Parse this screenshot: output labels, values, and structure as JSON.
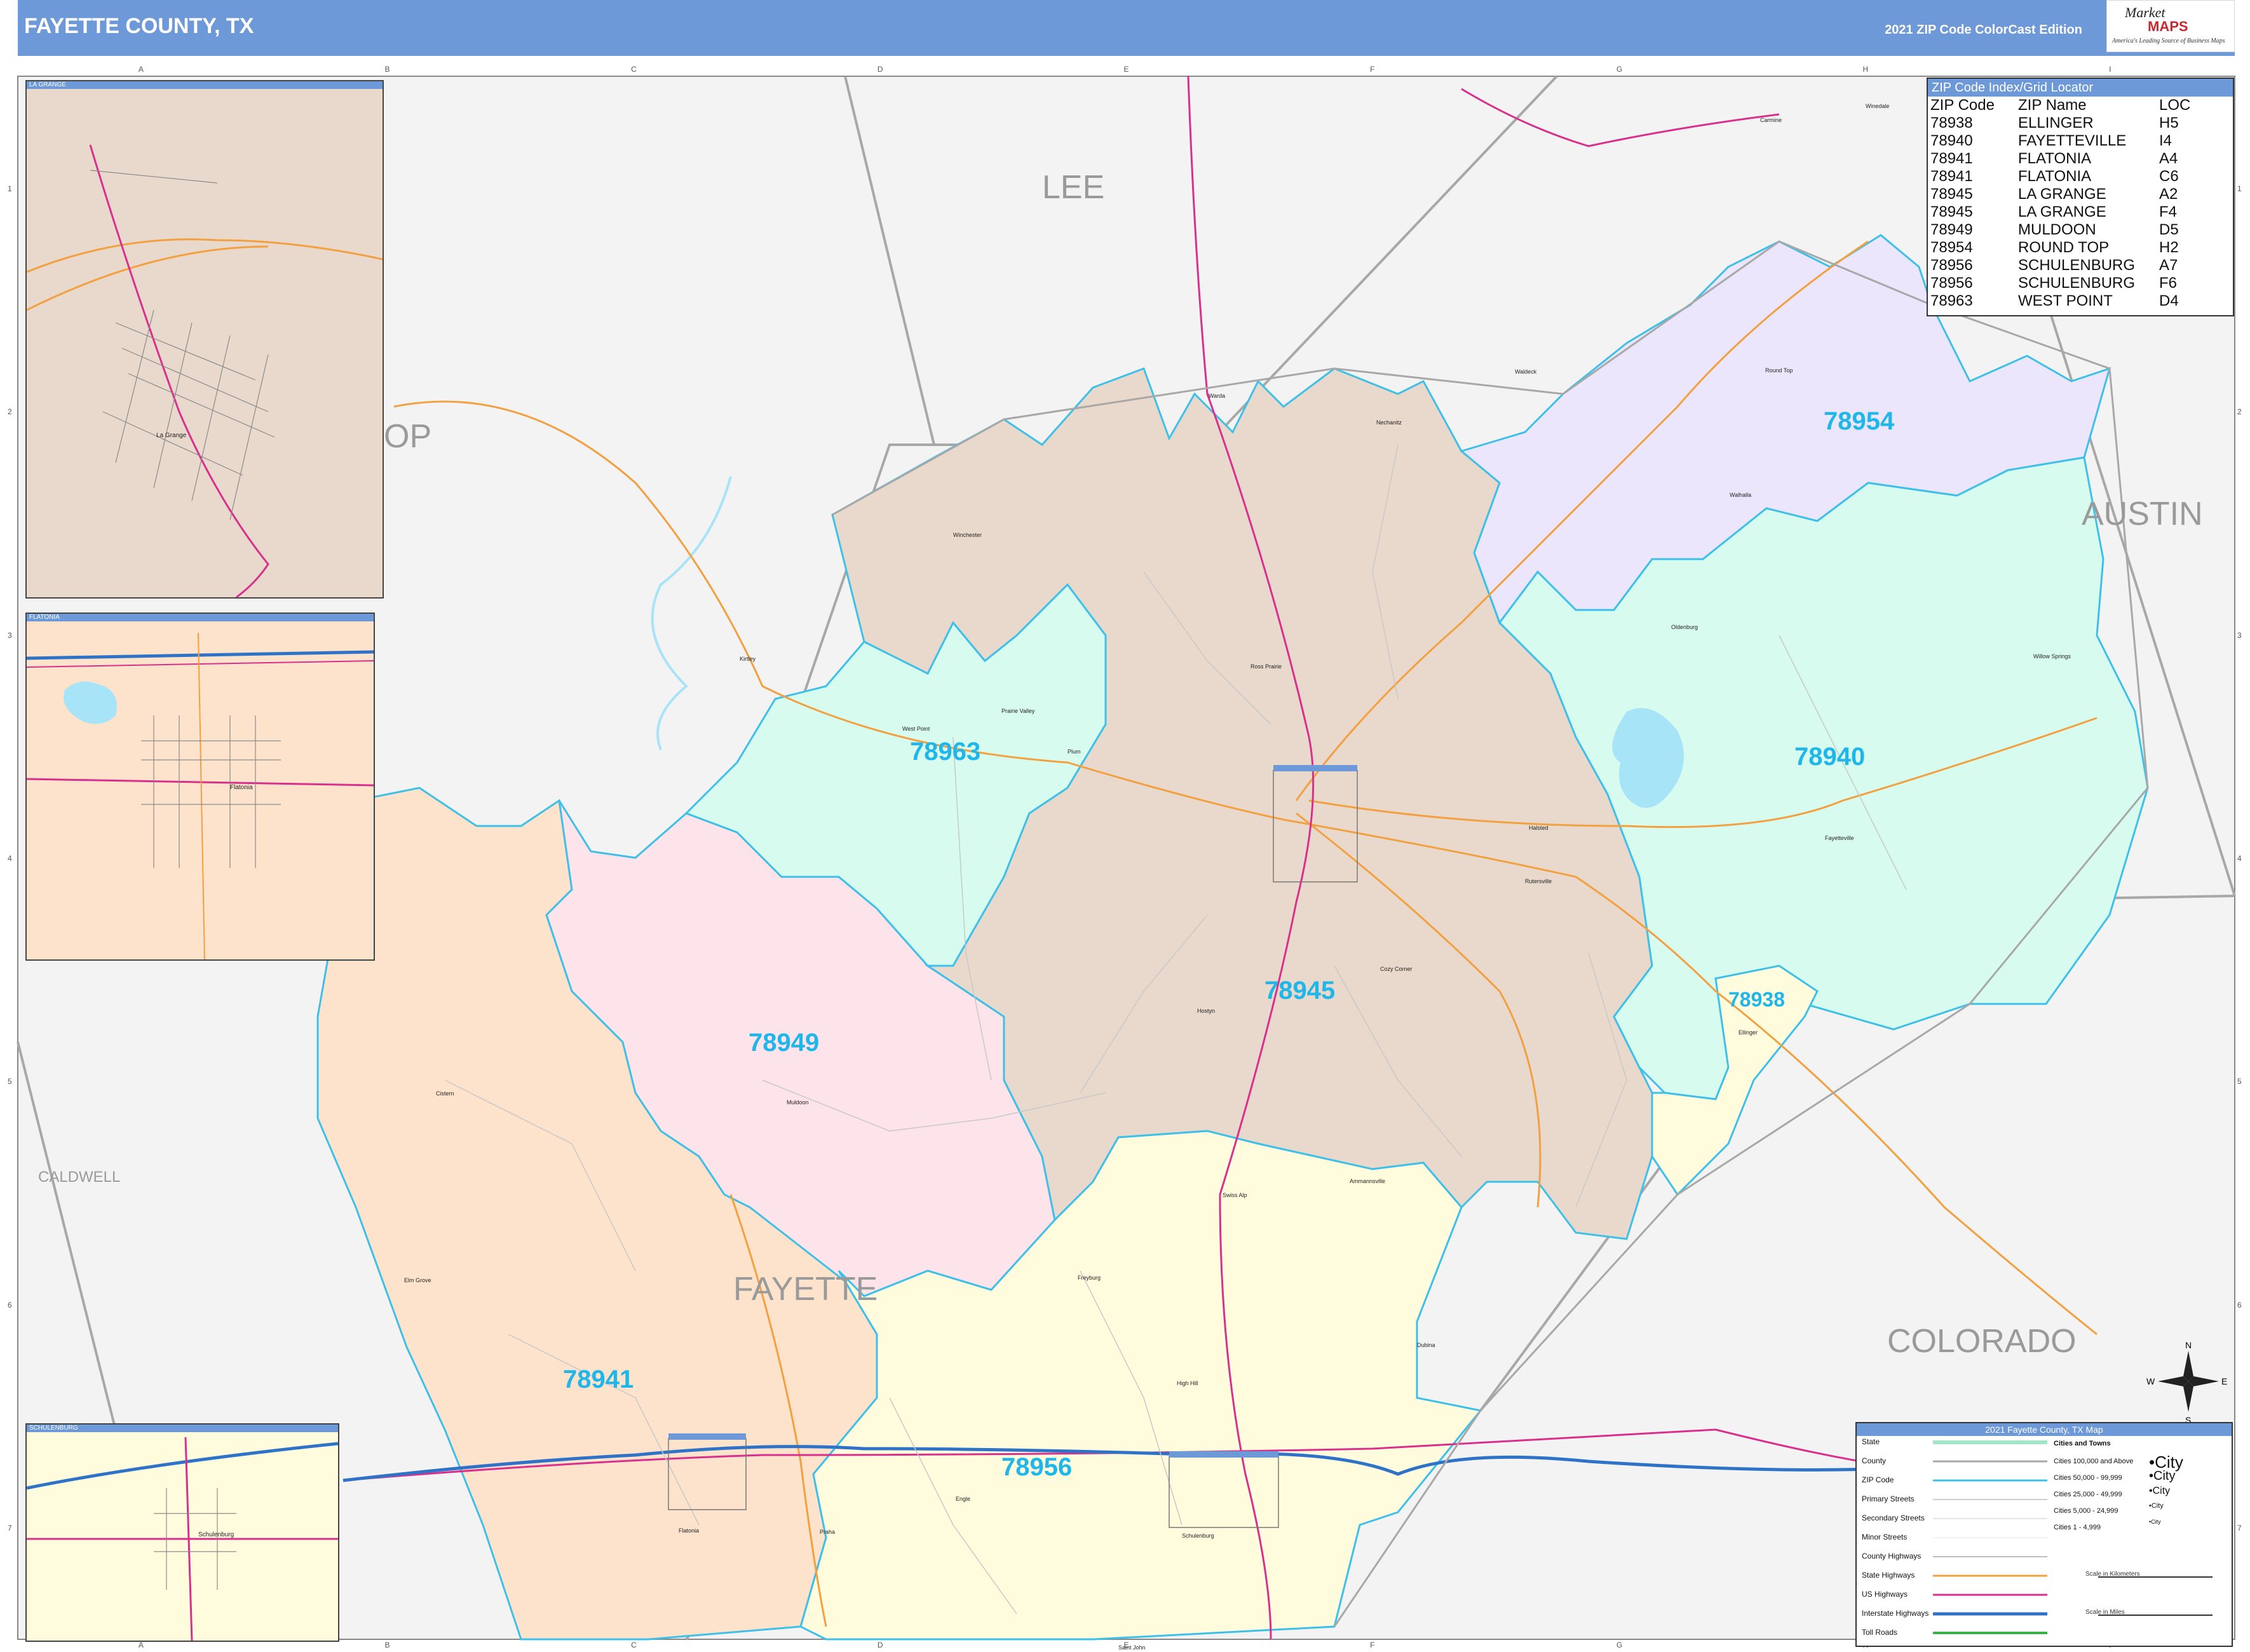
{
  "header": {
    "title": "FAYETTE COUNTY, TX",
    "edition": "2021 ZIP Code ColorCast Edition"
  },
  "logo": {
    "brand_a": "Market",
    "brand_b": "MAPS",
    "tagline": "America's Leading Source of Business Maps"
  },
  "grid": {
    "columns": [
      "A",
      "B",
      "C",
      "D",
      "E",
      "F",
      "G",
      "H",
      "I"
    ],
    "rows": [
      "1",
      "2",
      "3",
      "4",
      "5",
      "6",
      "7"
    ]
  },
  "counties": {
    "lee": "LEE",
    "bastrop_partial": "OP",
    "austin": "AUSTIN",
    "caldwell": "CALDWELL",
    "colorado": "COLORADO",
    "fayette": "FAYETTE"
  },
  "zip_areas": [
    {
      "zip": "78954",
      "color": "#ebe6fb"
    },
    {
      "zip": "78940",
      "color": "#d7fbee"
    },
    {
      "zip": "78963",
      "color": "#d7fbee"
    },
    {
      "zip": "78945",
      "color": "#e8d9cc"
    },
    {
      "zip": "78949",
      "color": "#fde3ea"
    },
    {
      "zip": "78941",
      "color": "#fde3cc"
    },
    {
      "zip": "78956",
      "color": "#fefcdd"
    },
    {
      "zip": "78938",
      "color": "#fefcdd"
    }
  ],
  "colors": {
    "header": "#6e99d8",
    "zip_label": "#1fb6ea",
    "zip_border": "#3ec0e8",
    "outside": "#f3f3f3",
    "state_hwy": "#f2a040",
    "us_hwy": "#d8308c",
    "interstate": "#2f73c8",
    "county_line": "#a8a8a8",
    "lake": "#a8e4f8"
  },
  "insets": {
    "la_grange": "LA GRANGE",
    "flatonia": "FLATONIA",
    "schulenburg": "SCHULENBURG"
  },
  "inset_towns": {
    "la_grange": "La Grange",
    "flatonia": "Flatonia",
    "schulenburg": "Schulenburg"
  },
  "towns": {
    "winchester": "Winchester",
    "warda": "Warda",
    "walhalla": "Walhalla",
    "round_top": "Round Top",
    "carmine": "Carmine",
    "oldenburg": "Oldenburg",
    "willow_springs": "Willow Springs",
    "fayetteville": "Fayetteville",
    "west_point": "West Point",
    "prairie_valley": "Prairie Valley",
    "plum": "Plum",
    "ledbetter": "Ledbetter",
    "rutersville": "Rutersville",
    "halsted": "Halsted",
    "ellinger": "Ellinger",
    "muldoon": "Muldoon",
    "flatonia": "Flatonia",
    "schulenburg": "Schulenburg",
    "engle": "Engle",
    "praha": "Praha",
    "freyburg": "Freyburg",
    "high_hill": "High Hill",
    "dubina": "Dubina",
    "ammannsville": "Ammannsville",
    "swiss_alp": "Swiss Alp",
    "cistern": "Cistern",
    "elm_grove": "Elm Grove",
    "winedale": "Winedale",
    "cozy_corner": "Cozy Corner",
    "kirtley": "Kirtley",
    "hostyn": "Hostyn",
    "waldeck": "Waldeck",
    "haw_creek": "Haw Creek",
    "swiss_alp_2": "Swiss Alp",
    "nechanitz": "Nechanitz",
    "saint_john": "Saint John",
    "lyons": "Lyons",
    "roznov": "Roznov",
    "ross_prairie": "Ross Prairie"
  },
  "zip_index": {
    "title": "ZIP Code Index/Grid Locator",
    "columns": [
      "ZIP Code",
      "ZIP Name",
      "LOC"
    ],
    "rows": [
      [
        "78938",
        "ELLINGER",
        "H5"
      ],
      [
        "78940",
        "FAYETTEVILLE",
        "I4"
      ],
      [
        "78941",
        "FLATONIA",
        "A4"
      ],
      [
        "78941",
        "FLATONIA",
        "C6"
      ],
      [
        "78945",
        "LA GRANGE",
        "A2"
      ],
      [
        "78945",
        "LA GRANGE",
        "F4"
      ],
      [
        "78949",
        "MULDOON",
        "D5"
      ],
      [
        "78954",
        "ROUND TOP",
        "H2"
      ],
      [
        "78956",
        "SCHULENBURG",
        "A7"
      ],
      [
        "78956",
        "SCHULENBURG",
        "F6"
      ],
      [
        "78963",
        "WEST POINT",
        "D4"
      ]
    ]
  },
  "legend": {
    "title": "2021 Fayette County, TX Map",
    "items": [
      "State",
      "County",
      "ZIP Code",
      "Primary Streets",
      "Secondary Streets",
      "Minor Streets",
      "County Highways",
      "State Highways",
      "US Highways",
      "Interstate Highways",
      "Toll Roads"
    ],
    "city_title": "Cities and Towns",
    "city_sizes": [
      "Cities 100,000 and Above",
      "Cities 50,000 - 99,999",
      "Cities 25,000 - 49,999",
      "Cities 5,000 - 24,999",
      "Cities 1 - 4,999"
    ],
    "city_sample": "City",
    "scale_km": "Scale in Kilometers",
    "scale_mi": "Scale in Miles"
  },
  "compass": {
    "n": "N",
    "s": "S",
    "e": "E",
    "w": "W"
  }
}
